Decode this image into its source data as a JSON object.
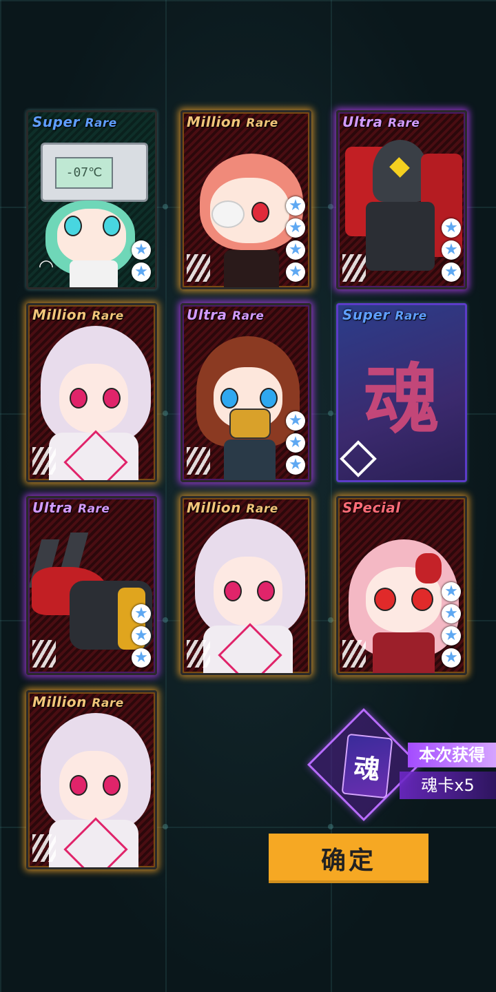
{
  "cards": [
    {
      "rarity_main": "Super",
      "rarity_sub": "Rare",
      "rarity_class": "r-sr",
      "glow": "none",
      "stars": 2,
      "emblem": "wifi-icon",
      "display": "-07℃"
    },
    {
      "rarity_main": "Million",
      "rarity_sub": "Rare",
      "rarity_class": "r-mr",
      "glow": "gold",
      "stars": 4,
      "emblem": "stripes"
    },
    {
      "rarity_main": "Ultra",
      "rarity_sub": "Rare",
      "rarity_class": "r-ur",
      "glow": "purple",
      "stars": 3,
      "emblem": "stripes"
    },
    {
      "rarity_main": "Million",
      "rarity_sub": "Rare",
      "rarity_class": "r-mr",
      "glow": "gold",
      "stars": 0,
      "emblem": "stripes"
    },
    {
      "rarity_main": "Ultra",
      "rarity_sub": "Rare",
      "rarity_class": "r-ur",
      "glow": "purple",
      "stars": 3,
      "emblem": "stripes"
    },
    {
      "rarity_main": "Super",
      "rarity_sub": "Rare",
      "rarity_class": "r-sr",
      "glow": "none",
      "stars": 0,
      "emblem": "diamond-icon",
      "soul_char": "魂"
    },
    {
      "rarity_main": "Ultra",
      "rarity_sub": "Rare",
      "rarity_class": "r-ur",
      "glow": "purple",
      "stars": 3,
      "emblem": "stripes"
    },
    {
      "rarity_main": "Million",
      "rarity_sub": "Rare",
      "rarity_class": "r-mr",
      "glow": "gold",
      "stars": 0,
      "emblem": "stripes"
    },
    {
      "rarity_main": "SPecial",
      "rarity_sub": "",
      "rarity_class": "r-sp",
      "glow": "gold",
      "stars": 4,
      "emblem": "stripes"
    },
    {
      "rarity_main": "Million",
      "rarity_sub": "Rare",
      "rarity_class": "r-mr",
      "glow": "gold",
      "stars": 0,
      "emblem": "stripes"
    }
  ],
  "reward": {
    "card_char": "魂",
    "label": "本次获得",
    "count": "魂卡x5"
  },
  "confirm_label": "确定",
  "colors": {
    "gold_glow": "#f0a028",
    "purple_glow": "#aa3ce6",
    "button": "#f6a823"
  }
}
